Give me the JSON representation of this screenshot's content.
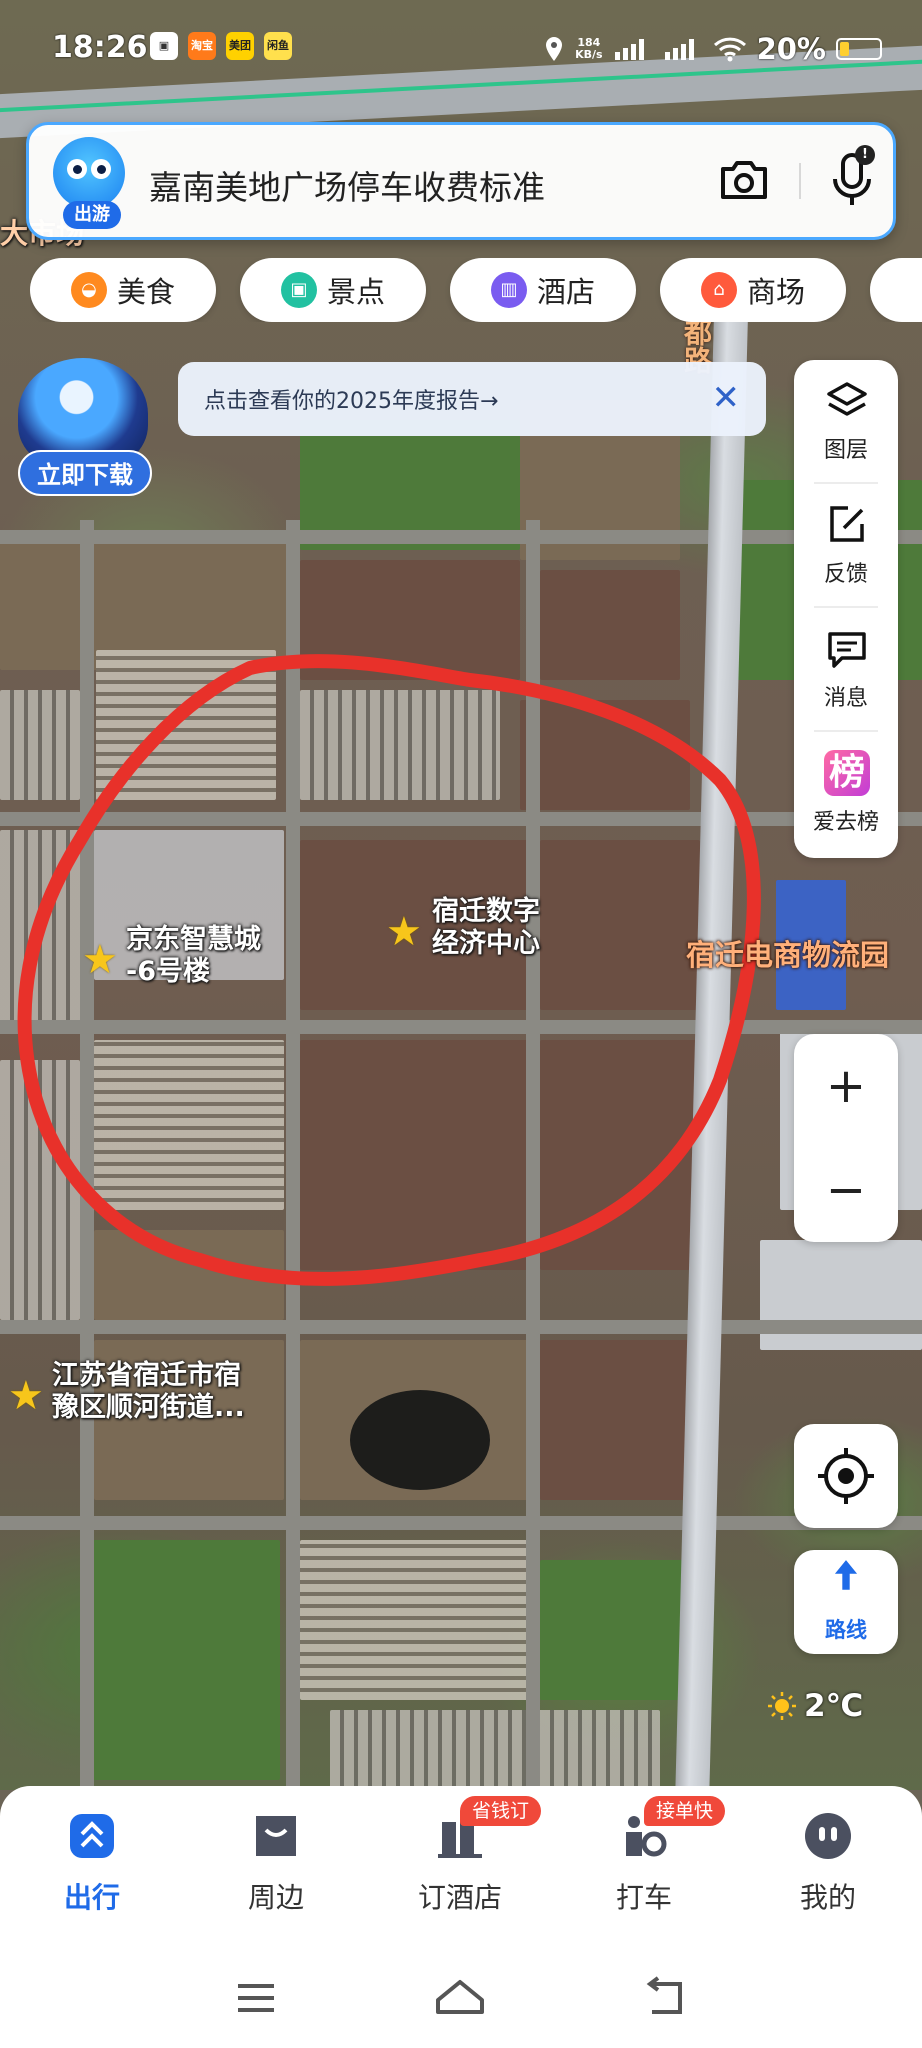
{
  "status_bar": {
    "time": "18:26",
    "app_badges": [
      "淘宝",
      "美团",
      "闲鱼"
    ],
    "network_speed": "184\nKB/s",
    "battery": "20%"
  },
  "search": {
    "avatar_tag": "出游",
    "query": "嘉南美地广场停车收费标准",
    "mic_badge": "!"
  },
  "chips": [
    {
      "label": "美食",
      "color": "#ff8a1f",
      "icon": "bowl-icon"
    },
    {
      "label": "景点",
      "color": "#22c1a1",
      "icon": "photo-icon"
    },
    {
      "label": "酒店",
      "color": "#7a5cf0",
      "icon": "hotel-icon"
    },
    {
      "label": "商场",
      "color": "#ff5a3c",
      "icon": "mall-icon"
    }
  ],
  "report_banner": {
    "text": "点击查看你的2025年度报告→",
    "close": "✕"
  },
  "download_widget": {
    "button": "立即下载"
  },
  "tools": [
    {
      "label": "图层",
      "icon": "layers-icon"
    },
    {
      "label": "反馈",
      "icon": "feedback-icon"
    },
    {
      "label": "消息",
      "icon": "message-icon"
    },
    {
      "label": "爱去榜",
      "icon": "ranking-icon"
    }
  ],
  "ranking_badge": "榜",
  "zoom": {
    "in": "+",
    "out": "−"
  },
  "route_button": {
    "label": "路线"
  },
  "weather": {
    "temperature": "2℃"
  },
  "map_labels": {
    "poi_1": "京东智慧城\n-6号楼",
    "poi_2": "宿迁数字\n经济中心",
    "poi_3": "江苏省宿迁市宿\n豫区顺河街道...",
    "area": "宿迁电商物流园",
    "top_left_fragment": "大市场",
    "road": "都路"
  },
  "bottom_nav": [
    {
      "label": "出行",
      "active": true,
      "badge": ""
    },
    {
      "label": "周边",
      "active": false,
      "badge": ""
    },
    {
      "label": "订酒店",
      "active": false,
      "badge": "省钱订"
    },
    {
      "label": "打车",
      "active": false,
      "badge": "接单快"
    },
    {
      "label": "我的",
      "active": false,
      "badge": ""
    }
  ],
  "colors": {
    "accent": "#1f6be8",
    "annotation_red": "#e8312a",
    "badge_red": "#f0493a"
  }
}
